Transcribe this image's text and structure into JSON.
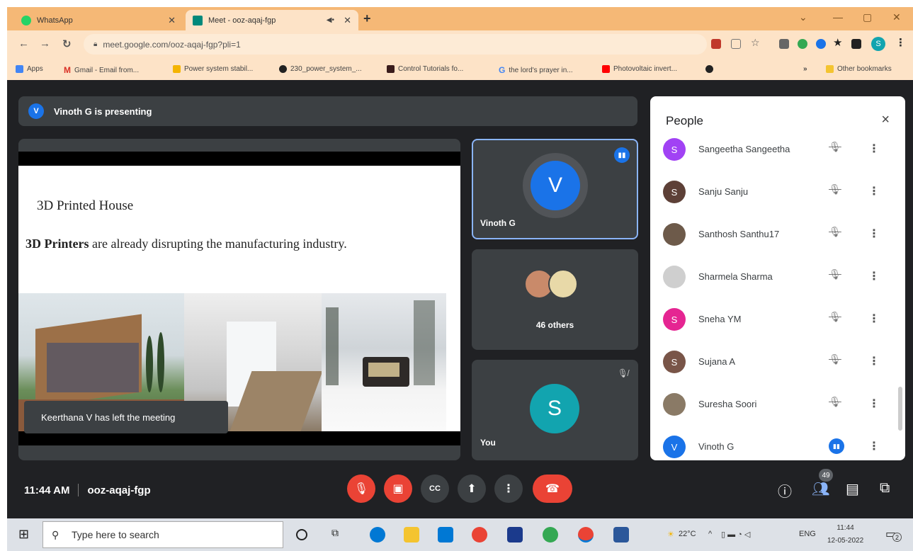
{
  "browser": {
    "tabs": [
      {
        "title": "WhatsApp",
        "active": false
      },
      {
        "title": "Meet - ooz-aqaj-fgp",
        "active": true
      }
    ],
    "new_tab": "+",
    "url": "meet.google.com/ooz-aqaj-fgp?pli=1",
    "bookmarks": [
      "Apps",
      "Gmail - Email from...",
      "Power system stabil...",
      "230_power_system_...",
      "Control Tutorials fo...",
      "the lord's prayer in...",
      "Photovoltaic invert..."
    ],
    "bookmarks_overflow": "»",
    "other_bookmarks": "Other bookmarks",
    "profile_initial": "S"
  },
  "meet": {
    "presenting_text": "Vinoth G is presenting",
    "presenter_initial": "V",
    "slide": {
      "title": "3D Printed House",
      "text_bold": "3D Printers",
      "text_rest": " are already disrupting the manufacturing industry."
    },
    "toast": "Keerthana V has left the meeting",
    "tiles": {
      "presenter": {
        "name": "Vinoth G",
        "initial": "V"
      },
      "others": {
        "label": "46 others"
      },
      "self": {
        "name": "You",
        "initial": "S"
      }
    },
    "people_panel": {
      "title": "People",
      "close": "×",
      "participants": [
        {
          "name": "Sangeetha Sangeetha",
          "initial": "S",
          "color": "#a142f4"
        },
        {
          "name": "Sanju Sanju",
          "initial": "S",
          "color": "#5d4037"
        },
        {
          "name": "Santhosh Santhu17",
          "initial": "",
          "color": "#6d5a4a"
        },
        {
          "name": "Sharmela Sharma",
          "initial": "",
          "color": "#cfcfcf"
        },
        {
          "name": "Sneha YM",
          "initial": "S",
          "color": "#e52592"
        },
        {
          "name": "Sujana A",
          "initial": "S",
          "color": "#795548"
        },
        {
          "name": "Suresha Soori",
          "initial": "",
          "color": "#8a7a66"
        },
        {
          "name": "Vinoth G",
          "initial": "V",
          "color": "#1a73e8"
        }
      ]
    },
    "bottom": {
      "time": "11:44 AM",
      "meeting_code": "ooz-aqaj-fgp",
      "people_count": "49"
    }
  },
  "taskbar": {
    "search_placeholder": "Type here to search",
    "temperature": "22°C",
    "language": "ENG",
    "clock_time": "11:44",
    "clock_date": "12-05-2022",
    "notification_count": "2"
  },
  "colors": {
    "accent": "#1a73e8",
    "end_call": "#ea4335",
    "meet_bg": "#202124",
    "tile_bg": "#3c4043",
    "self_avatar": "#12a4af"
  }
}
